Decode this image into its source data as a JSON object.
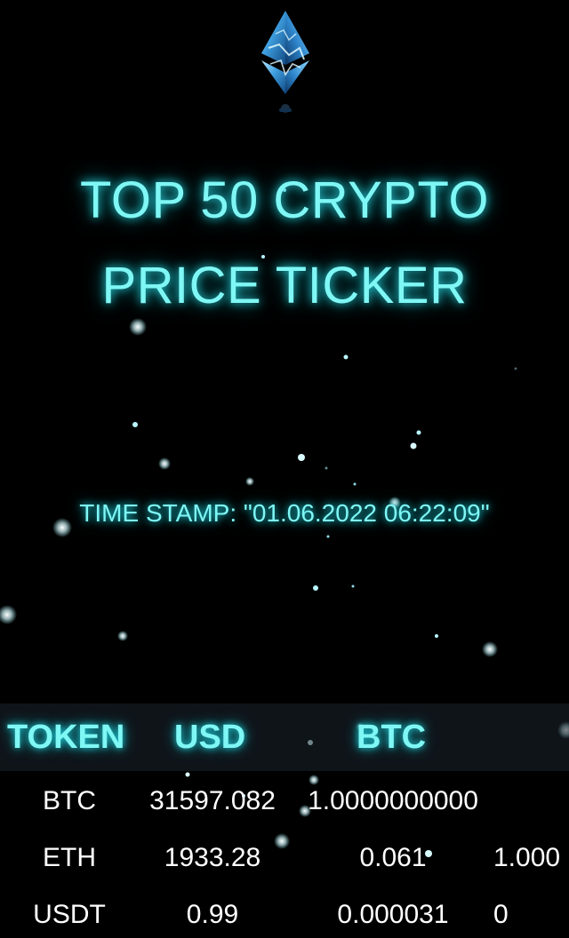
{
  "logo": {
    "icon": "ethereum-crystal-icon",
    "accent_color": "#35a9e6"
  },
  "title": {
    "line1": "TOP 50 CRYPTO",
    "line2": "PRICE TICKER",
    "color": "#7ff7f5"
  },
  "timestamp": {
    "label": "TIME STAMP: \"01.06.2022 06:22:09\""
  },
  "table": {
    "headers": [
      "TOKEN",
      "USD",
      "BTC"
    ],
    "rows": [
      {
        "token": "BTC",
        "usd": "31597.082",
        "btc": "1.0000000000",
        "next": ""
      },
      {
        "token": "ETH",
        "usd": "1933.28",
        "btc": "0.061",
        "next": "1.000"
      },
      {
        "token": "USDT",
        "usd": "0.99",
        "btc": "0.000031",
        "next": "0"
      }
    ]
  }
}
